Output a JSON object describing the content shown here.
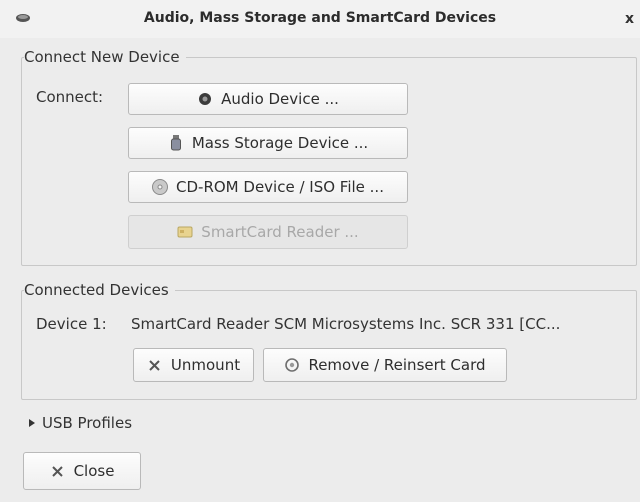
{
  "window": {
    "title": "Audio, Mass Storage and SmartCard Devices",
    "close_glyph": "x",
    "icon": "app-icon"
  },
  "connect_new": {
    "section_label": "Connect New Device",
    "connect_label": "Connect:",
    "buttons": {
      "audio": {
        "label": "Audio Device ...",
        "icon": "speaker-icon",
        "enabled": true
      },
      "mass_storage": {
        "label": "Mass Storage Device ...",
        "icon": "usb-drive-icon",
        "enabled": true
      },
      "cdrom": {
        "label": "CD-ROM Device / ISO File ...",
        "icon": "disc-icon",
        "enabled": true
      },
      "smartcard": {
        "label": "SmartCard Reader ...",
        "icon": "smartcard-icon",
        "enabled": false
      }
    }
  },
  "connected": {
    "section_label": "Connected Devices",
    "devices": [
      {
        "label": "Device 1:",
        "name": "SmartCard Reader SCM Microsystems Inc. SCR 331 [CC..."
      }
    ],
    "unmount_label": "Unmount",
    "remove_reinsert_label": "Remove / Reinsert Card"
  },
  "usb_profiles": {
    "label": "USB Profiles",
    "expanded": false
  },
  "footer": {
    "close_label": "Close"
  },
  "colors": {
    "background": "#ececec",
    "border": "#c8c8c8",
    "disabled_text": "#a8a8a8"
  }
}
